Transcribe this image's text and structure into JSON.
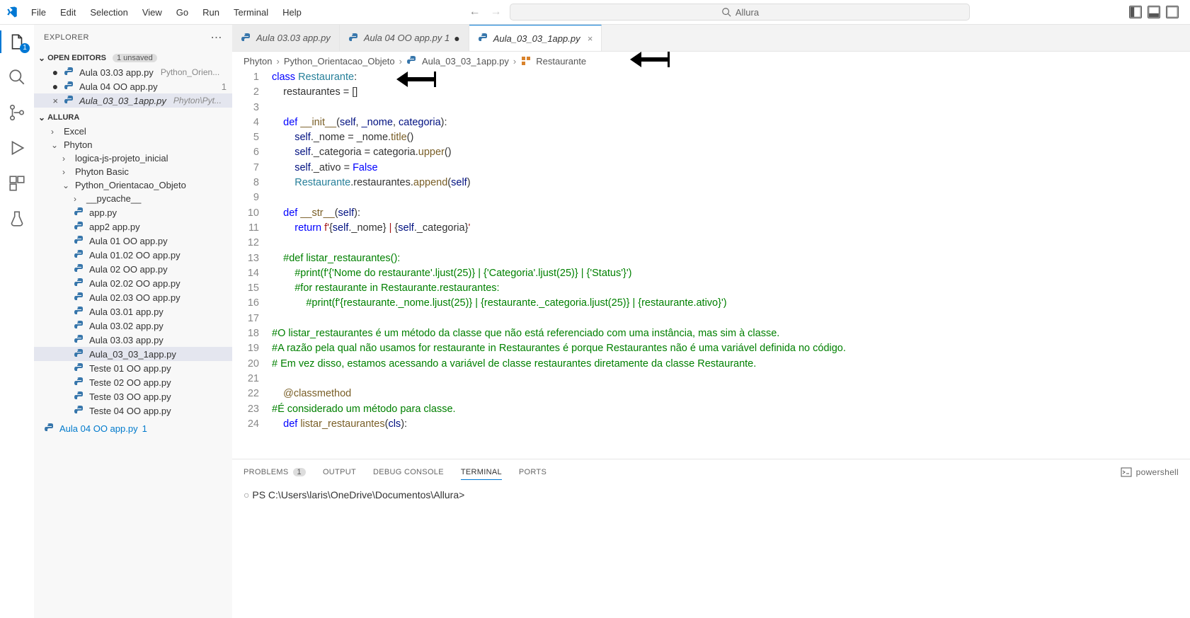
{
  "menu": [
    "File",
    "Edit",
    "Selection",
    "View",
    "Go",
    "Run",
    "Terminal",
    "Help"
  ],
  "search_placeholder": "Allura",
  "explorer": {
    "title": "EXPLORER",
    "open_editors_label": "OPEN EDITORS",
    "unsaved_label": "1 unsaved",
    "open_editors": [
      {
        "name": "Aula 03.03 app.py",
        "detail": "Python_Orien...",
        "status": "dot"
      },
      {
        "name": "Aula 04 OO app.py",
        "detail": "",
        "status": "dot",
        "right": "1"
      },
      {
        "name": "Aula_03_03_1app.py",
        "detail": "Phyton\\Pyt...",
        "status": "close",
        "italic": true,
        "selected": true
      }
    ],
    "workspace_label": "ALLURA",
    "tree": [
      {
        "type": "folder",
        "name": "Excel",
        "indent": 1,
        "open": false
      },
      {
        "type": "folder",
        "name": "Phyton",
        "indent": 1,
        "open": true
      },
      {
        "type": "folder",
        "name": "logica-js-projeto_inicial",
        "indent": 2,
        "open": false
      },
      {
        "type": "folder",
        "name": "Phyton Basic",
        "indent": 2,
        "open": false
      },
      {
        "type": "folder",
        "name": "Python_Orientacao_Objeto",
        "indent": 2,
        "open": true
      },
      {
        "type": "folder",
        "name": "__pycache__",
        "indent": 3,
        "open": false
      },
      {
        "type": "file",
        "name": "app.py",
        "indent": 3
      },
      {
        "type": "file",
        "name": "app2 app.py",
        "indent": 3
      },
      {
        "type": "file",
        "name": "Aula 01 OO app.py",
        "indent": 3
      },
      {
        "type": "file",
        "name": "Aula 01.02 OO app.py",
        "indent": 3
      },
      {
        "type": "file",
        "name": "Aula 02 OO app.py",
        "indent": 3
      },
      {
        "type": "file",
        "name": "Aula 02.02 OO app.py",
        "indent": 3
      },
      {
        "type": "file",
        "name": "Aula 02.03 OO app.py",
        "indent": 3
      },
      {
        "type": "file",
        "name": "Aula 03.01 app.py",
        "indent": 3
      },
      {
        "type": "file",
        "name": "Aula 03.02 app.py",
        "indent": 3
      },
      {
        "type": "file",
        "name": "Aula 03.03 app.py",
        "indent": 3
      },
      {
        "type": "file",
        "name": "Aula_03_03_1app.py",
        "indent": 3,
        "selected": true
      },
      {
        "type": "file",
        "name": "Teste 01 OO app.py",
        "indent": 3
      },
      {
        "type": "file",
        "name": "Teste 02 OO app.py",
        "indent": 3
      },
      {
        "type": "file",
        "name": "Teste 03 OO app.py",
        "indent": 3
      },
      {
        "type": "file",
        "name": "Teste 04 OO app.py",
        "indent": 3
      }
    ],
    "outline_item": {
      "name": "Aula 04 OO app.py",
      "right": "1"
    }
  },
  "tabs": [
    {
      "name": "Aula 03.03 app.py",
      "active": false,
      "modified": false
    },
    {
      "name": "Aula 04 OO app.py",
      "suffix": "1",
      "active": false,
      "modified": true
    },
    {
      "name": "Aula_03_03_1app.py",
      "active": true,
      "modified": false
    }
  ],
  "breadcrumb": [
    "Phyton",
    "Python_Orientacao_Objeto",
    "Aula_03_03_1app.py",
    "Restaurante"
  ],
  "code_lines": 24,
  "panel": {
    "tabs": [
      "PROBLEMS",
      "OUTPUT",
      "DEBUG CONSOLE",
      "TERMINAL",
      "PORTS"
    ],
    "problems_count": "1",
    "active": "TERMINAL",
    "shell_label": "powershell",
    "terminal_line": "PS C:\\Users\\laris\\OneDrive\\Documentos\\Allura>"
  },
  "code": {
    "l1": "class Restaurante:",
    "l2": "    restaurantes = []",
    "l4": "    def __init__(self, _nome, categoria):",
    "l5": "        self._nome = _nome.title()",
    "l6": "        self._categoria = categoria.upper()",
    "l7": "        self._ativo = False",
    "l8": "        Restaurante.restaurantes.append(self)",
    "l10": "    def __str__(self):",
    "l11": "        return f'{self._nome} | {self._categoria}'",
    "l13": "    #def listar_restaurantes():",
    "l14": "        #print(f'{'Nome do restaurante'.ljust(25)} | {'Categoria'.ljust(25)} | {'Status'}')",
    "l15": "        #for restaurante in Restaurante.restaurantes:",
    "l16": "            #print(f'{restaurante._nome.ljust(25)} | {restaurante._categoria.ljust(25)} | {restaurante.ativo}')",
    "l18": "#O listar_restaurantes é um método da classe que não está referenciado com uma instância, mas sim à classe.",
    "l19": "#A razão pela qual não usamos for restaurante in Restaurantes é porque Restaurantes não é uma variável definida no código.",
    "l20": "# Em vez disso, estamos acessando a variável de classe restaurantes diretamente da classe Restaurante.",
    "l22": "    @classmethod",
    "l23": "#É considerado um método para classe.",
    "l24": "    def listar_restaurantes(cls):"
  }
}
